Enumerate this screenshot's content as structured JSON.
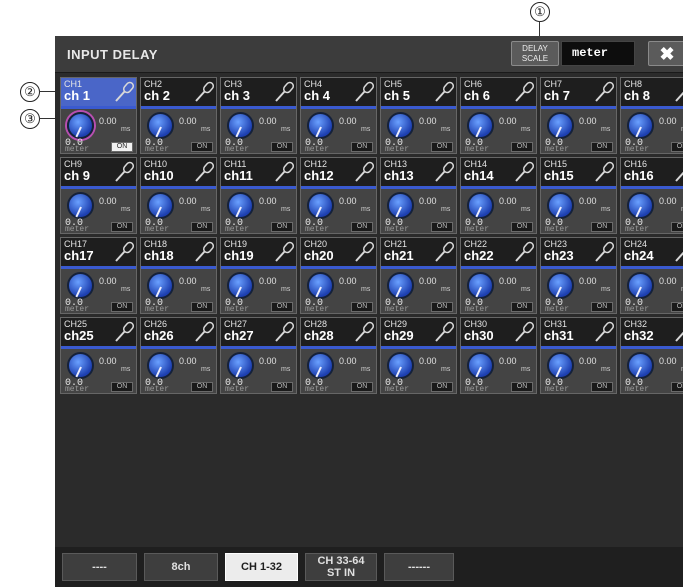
{
  "callouts": [
    "①",
    "②",
    "③"
  ],
  "title": "INPUT DELAY",
  "delay_scale": {
    "label_line1": "DELAY",
    "label_line2": "SCALE",
    "value": "meter"
  },
  "close_label": "✖",
  "channels": [
    {
      "num": "CH1",
      "name": "ch 1"
    },
    {
      "num": "CH2",
      "name": "ch 2"
    },
    {
      "num": "CH3",
      "name": "ch 3"
    },
    {
      "num": "CH4",
      "name": "ch 4"
    },
    {
      "num": "CH5",
      "name": "ch 5"
    },
    {
      "num": "CH6",
      "name": "ch 6"
    },
    {
      "num": "CH7",
      "name": "ch 7"
    },
    {
      "num": "CH8",
      "name": "ch 8"
    },
    {
      "num": "CH9",
      "name": "ch 9"
    },
    {
      "num": "CH10",
      "name": "ch10"
    },
    {
      "num": "CH11",
      "name": "ch11"
    },
    {
      "num": "CH12",
      "name": "ch12"
    },
    {
      "num": "CH13",
      "name": "ch13"
    },
    {
      "num": "CH14",
      "name": "ch14"
    },
    {
      "num": "CH15",
      "name": "ch15"
    },
    {
      "num": "CH16",
      "name": "ch16"
    },
    {
      "num": "CH17",
      "name": "ch17"
    },
    {
      "num": "CH18",
      "name": "ch18"
    },
    {
      "num": "CH19",
      "name": "ch19"
    },
    {
      "num": "CH20",
      "name": "ch20"
    },
    {
      "num": "CH21",
      "name": "ch21"
    },
    {
      "num": "CH22",
      "name": "ch22"
    },
    {
      "num": "CH23",
      "name": "ch23"
    },
    {
      "num": "CH24",
      "name": "ch24"
    },
    {
      "num": "CH25",
      "name": "ch25"
    },
    {
      "num": "CH26",
      "name": "ch26"
    },
    {
      "num": "CH27",
      "name": "ch27"
    },
    {
      "num": "CH28",
      "name": "ch28"
    },
    {
      "num": "CH29",
      "name": "ch29"
    },
    {
      "num": "CH30",
      "name": "ch30"
    },
    {
      "num": "CH31",
      "name": "ch31"
    },
    {
      "num": "CH32",
      "name": "ch32"
    }
  ],
  "channel_common": {
    "time": "0.00",
    "unit": "ms",
    "value": "0.0",
    "scale": "meter",
    "on_label": "ON"
  },
  "selected_channel": "CH1",
  "tabs": [
    {
      "line1": "----",
      "line2": ""
    },
    {
      "line1": "8ch",
      "line2": ""
    },
    {
      "line1": "CH 1-32",
      "line2": ""
    },
    {
      "line1": "CH 33-64",
      "line2": "ST IN"
    },
    {
      "line1": "------",
      "line2": ""
    }
  ],
  "active_tab": "CH 1-32",
  "colors": {
    "knob": "#2f64d6",
    "selected_header": "#4a66c8",
    "accent_strip": "#3a5ad0",
    "callout_ring": "#b84fb0"
  }
}
